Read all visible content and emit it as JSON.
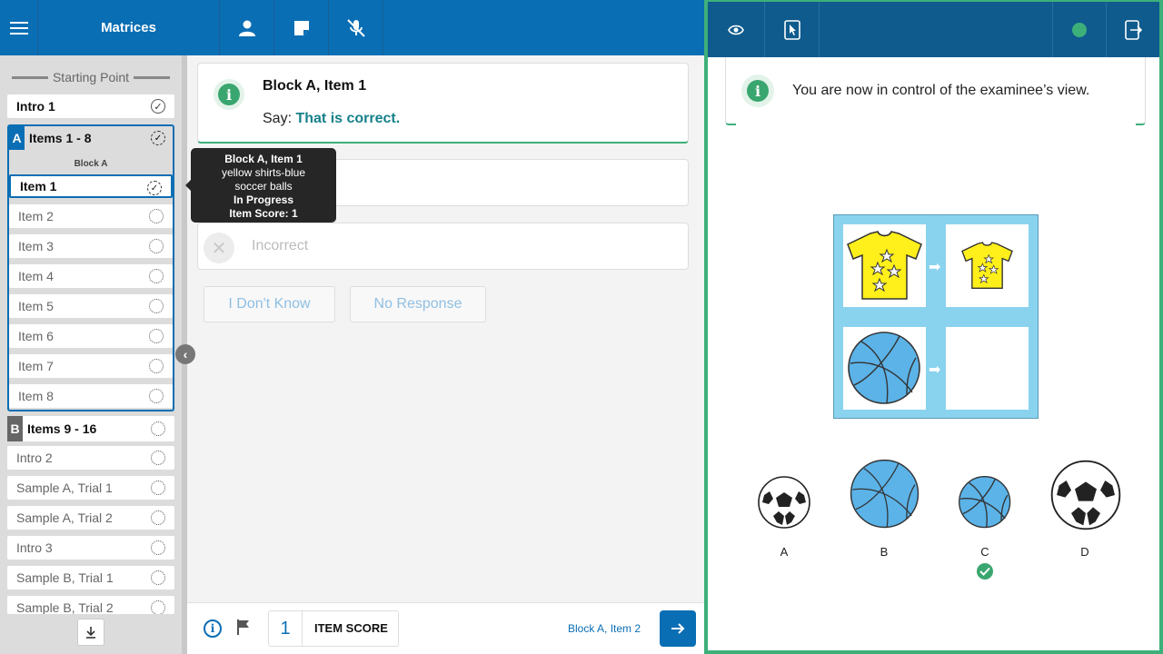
{
  "topbar": {
    "title": "Matrices"
  },
  "sidebar": {
    "starting_point": "Starting Point",
    "intro1": "Intro 1",
    "blockA": {
      "badge": "A",
      "title": "Items 1 - 8",
      "subtitle": "Block A"
    },
    "items_a": [
      "Item 1",
      "Item 2",
      "Item 3",
      "Item 4",
      "Item 5",
      "Item 6",
      "Item 7",
      "Item 8"
    ],
    "blockB": {
      "badge": "B",
      "title": "Items 9 - 16"
    },
    "after_items": [
      "Intro 2",
      "Sample A, Trial 1",
      "Sample A, Trial 2",
      "Intro 3",
      "Sample B, Trial 1",
      "Sample B, Trial 2"
    ]
  },
  "card": {
    "title": "Block A, Item 1",
    "say_prefix": "Say:",
    "say_text": "That is correct."
  },
  "incorrect_label": "Incorrect",
  "buttons": {
    "idk": "I Don't Know",
    "no_response": "No Response"
  },
  "tooltip": {
    "line1": "Block A, Item 1",
    "line2": "yellow shirts-blue",
    "line3": "soccer balls",
    "line4": "In Progress",
    "line5": "Item Score: 1"
  },
  "bottom": {
    "score": "1",
    "score_label": "ITEM SCORE",
    "next_label": "Block A, Item 2"
  },
  "right": {
    "control_text": "You are now in control of the examinee’s view.",
    "options": [
      "A",
      "B",
      "C",
      "D"
    ],
    "selected_option": "C",
    "status_color": "#3db07a"
  },
  "colors": {
    "primary": "#0a6eb4",
    "accent_green": "#3db07a",
    "teal_text": "#16808a"
  }
}
